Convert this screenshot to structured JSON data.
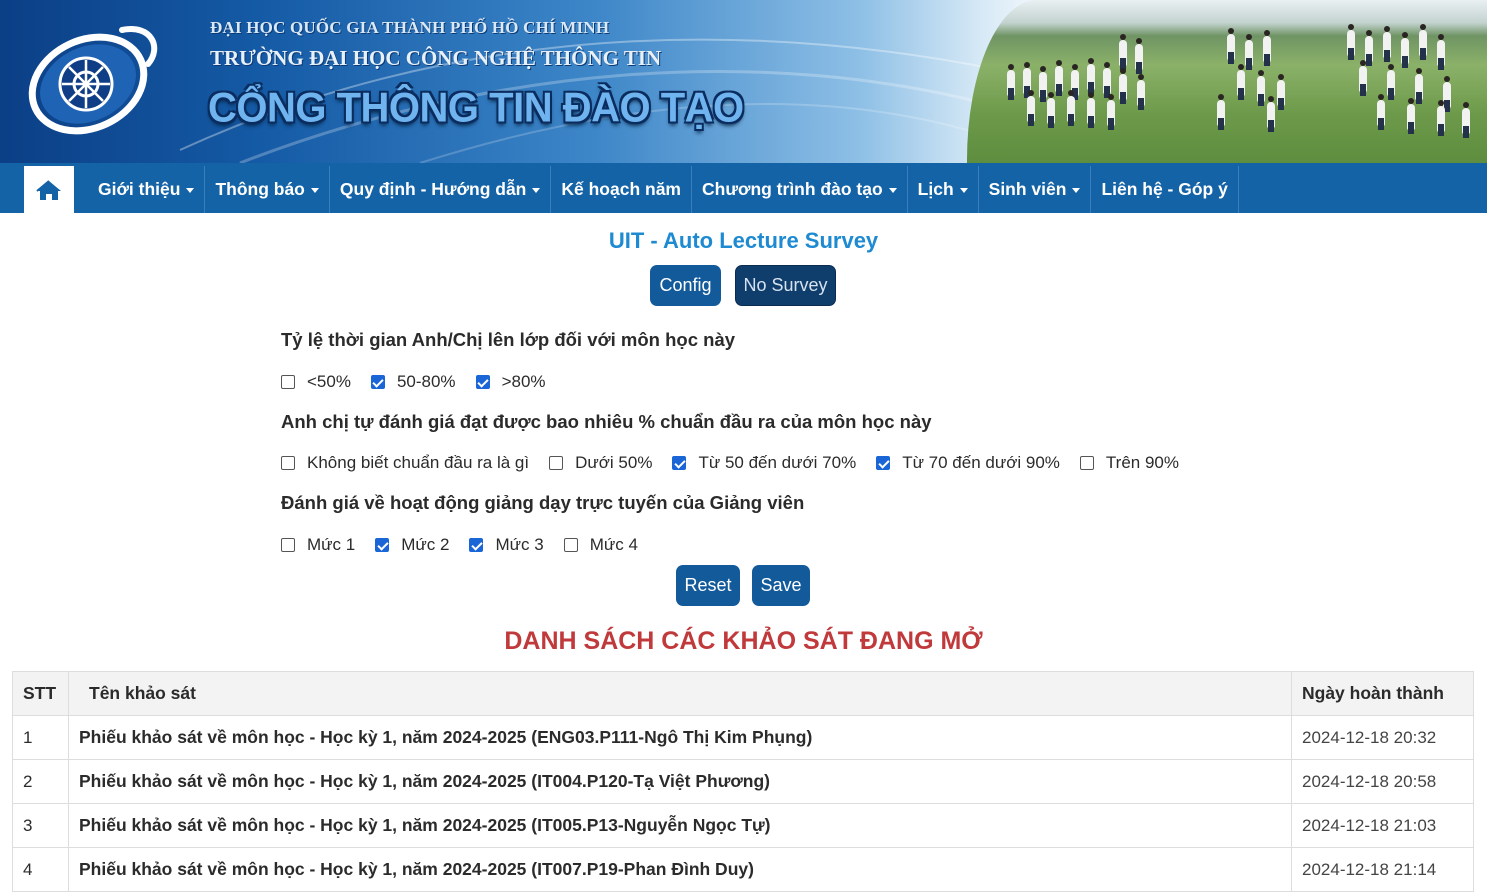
{
  "header": {
    "university_line1": "ĐẠI HỌC QUỐC GIA THÀNH PHỐ HỒ CHÍ MINH",
    "university_line2": "TRƯỜNG ĐẠI HỌC CÔNG NGHỆ THÔNG TIN",
    "portal_title": "CỔNG THÔNG TIN ĐÀO TẠO",
    "logo_icon": "uit-logo-icon",
    "photo": "students-photo"
  },
  "nav": {
    "home_icon": "home-icon",
    "items": [
      {
        "label": "Giới thiệu",
        "has_dropdown": true
      },
      {
        "label": "Thông báo",
        "has_dropdown": true
      },
      {
        "label": "Quy định - Hướng dẫn",
        "has_dropdown": true
      },
      {
        "label": "Kế hoạch năm",
        "has_dropdown": false
      },
      {
        "label": "Chương trình đào tạo",
        "has_dropdown": true
      },
      {
        "label": "Lịch",
        "has_dropdown": true
      },
      {
        "label": "Sinh viên",
        "has_dropdown": true
      },
      {
        "label": "Liên hệ - Góp ý",
        "has_dropdown": false
      }
    ]
  },
  "tool": {
    "title": "UIT - Auto Lecture Survey",
    "config_label": "Config",
    "no_survey_label": "No Survey",
    "questions": [
      {
        "label": "Tỷ lệ thời gian Anh/Chị lên lớp đối với môn học này",
        "options": [
          {
            "text": "<50%",
            "checked": false
          },
          {
            "text": "50-80%",
            "checked": true
          },
          {
            "text": ">80%",
            "checked": true
          }
        ]
      },
      {
        "label": "Anh chị tự đánh giá đạt được bao nhiêu % chuẩn đầu ra của môn học này",
        "options": [
          {
            "text": "Không biết chuẩn đầu ra là gì",
            "checked": false
          },
          {
            "text": "Dưới 50%",
            "checked": false
          },
          {
            "text": "Từ 50 đến dưới 70%",
            "checked": true
          },
          {
            "text": "Từ 70 đến dưới 90%",
            "checked": true
          },
          {
            "text": "Trên 90%",
            "checked": false
          }
        ]
      },
      {
        "label": "Đánh giá về hoạt động giảng dạy trực tuyến của Giảng viên",
        "options": [
          {
            "text": "Mức 1",
            "checked": false
          },
          {
            "text": "Mức 2",
            "checked": true
          },
          {
            "text": "Mức 3",
            "checked": true
          },
          {
            "text": "Mức 4",
            "checked": false
          }
        ]
      }
    ],
    "reset_label": "Reset",
    "save_label": "Save"
  },
  "list": {
    "title": "DANH SÁCH CÁC KHẢO SÁT ĐANG MỞ",
    "columns": [
      "STT",
      "Tên khảo sát",
      "Ngày hoàn thành"
    ],
    "rows": [
      {
        "stt": "1",
        "name": "Phiếu khảo sát về môn học - Học kỳ 1, năm 2024-2025 (ENG03.P111-Ngô Thị Kim Phụng)",
        "date": "2024-12-18 20:32"
      },
      {
        "stt": "2",
        "name": "Phiếu khảo sát về môn học - Học kỳ 1, năm 2024-2025 (IT004.P120-Tạ Việt Phương)",
        "date": "2024-12-18 20:58"
      },
      {
        "stt": "3",
        "name": "Phiếu khảo sát về môn học - Học kỳ 1, năm 2024-2025 (IT005.P13-Nguyễn Ngọc Tự)",
        "date": "2024-12-18 21:03"
      },
      {
        "stt": "4",
        "name": "Phiếu khảo sát về môn học - Học kỳ 1, năm 2024-2025 (IT007.P19-Phan Đình Duy)",
        "date": "2024-12-18 21:14"
      }
    ]
  },
  "colors": {
    "nav_bg": "#1463a6",
    "tool_title": "#1d8ad1",
    "button_primary": "#135a9b",
    "button_dark": "#0f3e6d",
    "list_title": "#c0393b",
    "checkbox_checked": "#1a66d6"
  }
}
